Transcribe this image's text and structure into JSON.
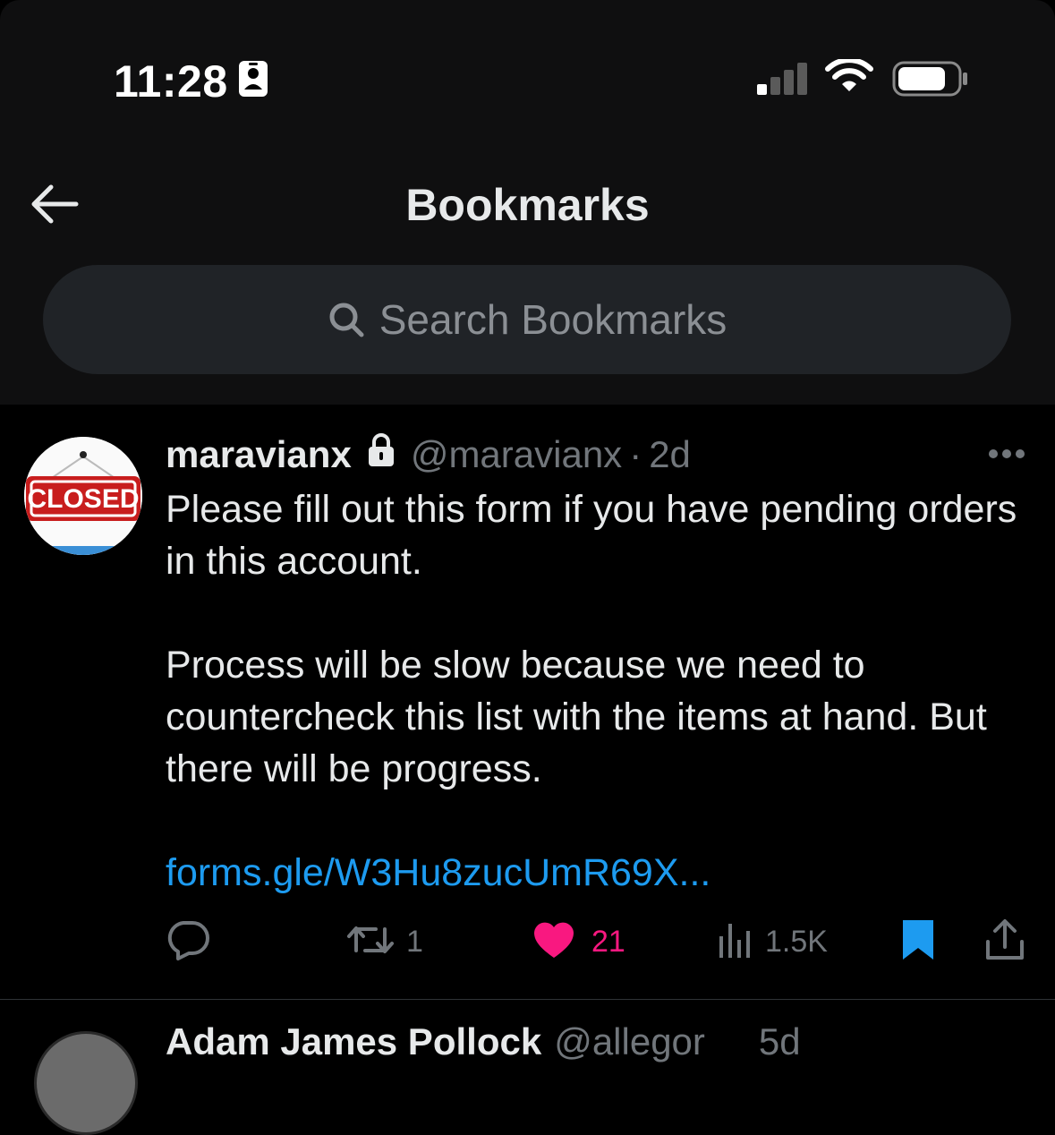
{
  "status_bar": {
    "time": "11:28"
  },
  "header": {
    "title": "Bookmarks",
    "search_placeholder": "Search Bookmarks"
  },
  "tweet": {
    "avatar_text": "CLOSED",
    "display_name": "maravianx",
    "handle": "@maravianx",
    "separator": "·",
    "age": "2d",
    "paragraphs": [
      "Please fill out this form if you have pending orders in this account.",
      "Process will be slow because we need to countercheck this list with the items at hand. But there will be progress."
    ],
    "link": "forms.gle/W3Hu8zucUmR69X...",
    "stats": {
      "retweets": "1",
      "likes": "21",
      "views": "1.5K"
    },
    "bookmarked": true,
    "liked": true
  },
  "next_tweet": {
    "display_name": "Adam James Pollock",
    "handle": "@allegor",
    "age": "5d"
  },
  "colors": {
    "accent": "#1d9bf0",
    "like": "#f91880",
    "muted": "#71767b",
    "background": "#000000"
  }
}
